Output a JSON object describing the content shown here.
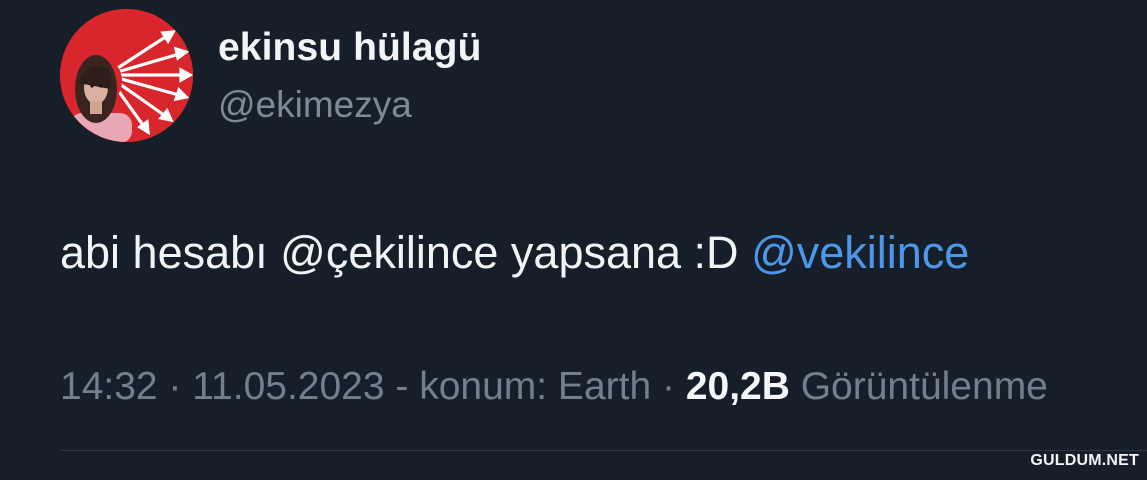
{
  "profile": {
    "display_name": "ekinsu hülagü",
    "handle": "@ekimezya"
  },
  "tweet": {
    "text": "abi hesabı @çekilince yapsana :D ",
    "mention": "@vekilince"
  },
  "meta": {
    "prefix": "14:32 · 11.05.2023 - konum: Earth · ",
    "views_count": "20,2B",
    "views_label": " Görüntülenme"
  },
  "watermark": {
    "text": "GULDUM.NET"
  },
  "colors": {
    "background": "#161e29",
    "mention": "#4c97ea",
    "avatar_red": "#d8262c"
  }
}
